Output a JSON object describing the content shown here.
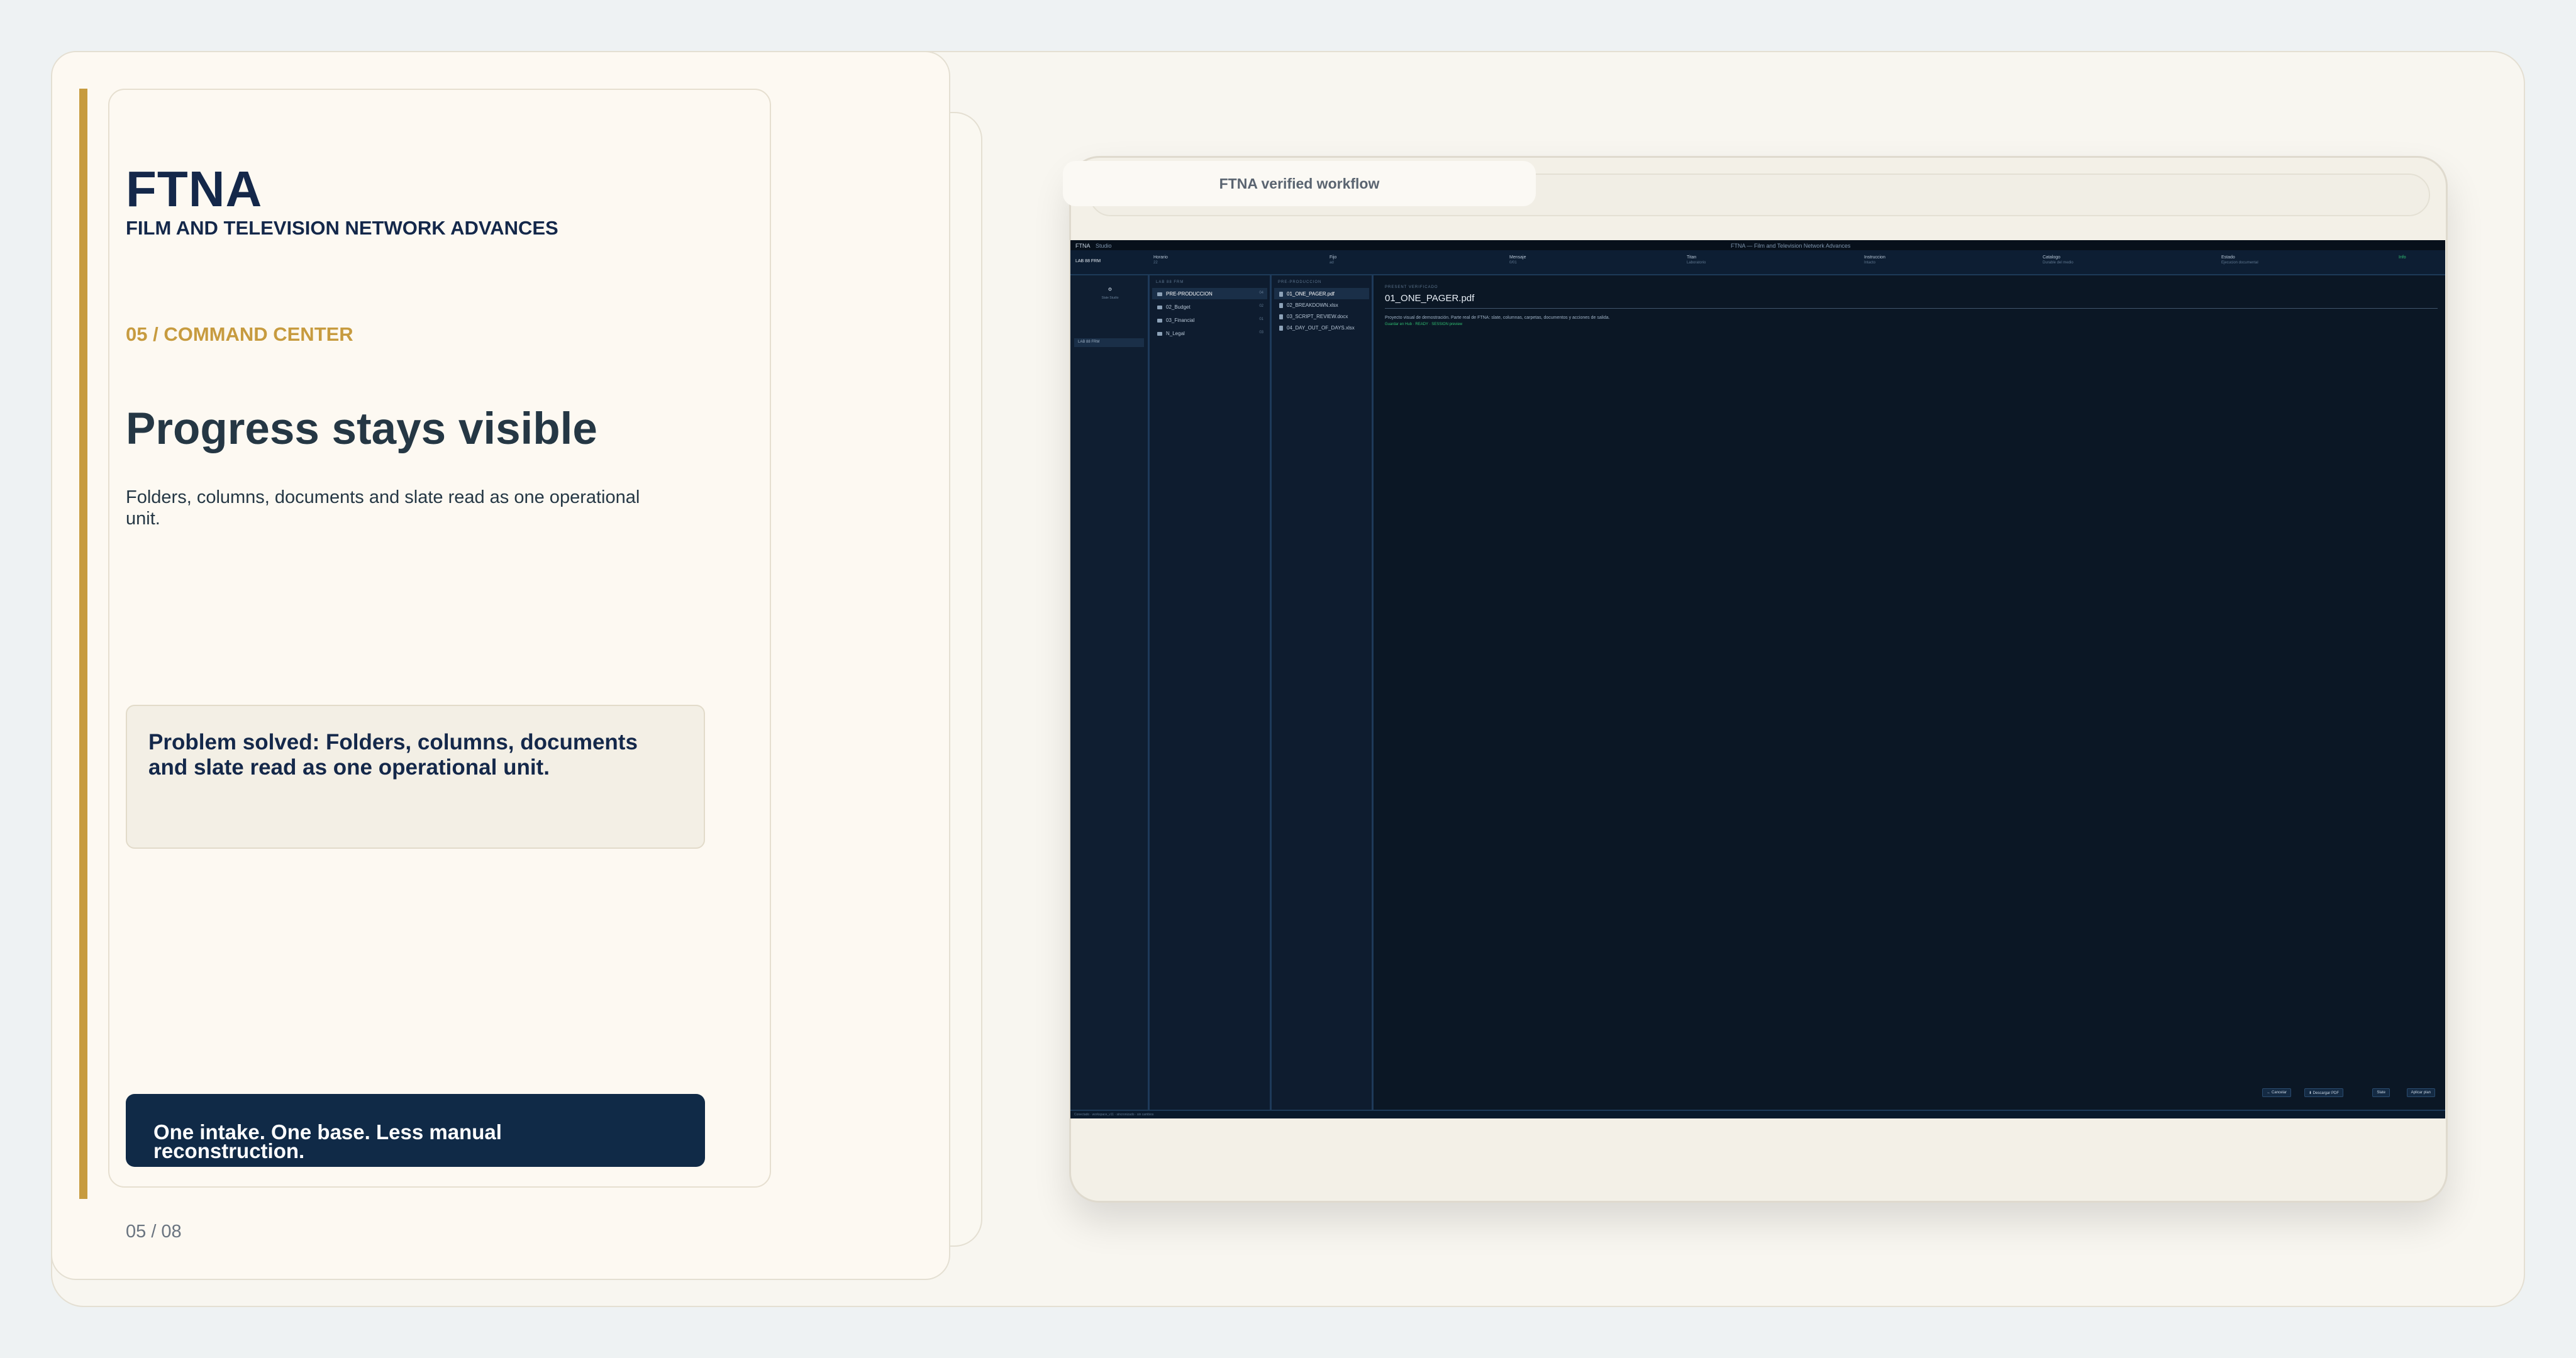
{
  "slide": {
    "brand": "FTNA",
    "brand_subtitle": "FILM AND TELEVISION NETWORK ADVANCES",
    "section": "05 / COMMAND CENTER",
    "headline": "Progress stays visible",
    "body": "Folders, columns, documents and slate read as one operational unit.",
    "problem": "Problem solved: Folders, columns, documents and slate read as one operational unit.",
    "cta": "One intake. One base. Less manual reconstruction.",
    "pager": "05 / 08"
  },
  "device": {
    "tab_label": "FTNA verified workflow"
  },
  "app": {
    "top_left": "FTNA",
    "top_menu": "Studio",
    "top_center": "FTNA — Film and Television Network Advances",
    "nav": [
      {
        "label": "Horario",
        "sub": "22"
      },
      {
        "label": "Fijo",
        "sub": "ad"
      },
      {
        "label": "Mensaje",
        "sub": "0/01"
      },
      {
        "label": "Titan",
        "sub": "Laboratorio"
      },
      {
        "label": "Instruccion",
        "sub": "Intacto"
      },
      {
        "label": "Catalogo",
        "sub": "Durable del medio"
      },
      {
        "label": "Estado",
        "sub": "Ejecucion documental"
      },
      {
        "label": "Info",
        "sub": ""
      }
    ],
    "side": {
      "logo_caption": "Slate Studio",
      "item": "LAB 88 FRM"
    },
    "folders_head": "LAB 88 FRM",
    "folders": [
      {
        "label": "PRE-PRODUCCION",
        "count": "04"
      },
      {
        "label": "02_Budget",
        "count": "02"
      },
      {
        "label": "03_Financial",
        "count": "01"
      },
      {
        "label": "N_Legal",
        "count": "03"
      }
    ],
    "files_head": "PRE-PRODUCCION",
    "files": [
      {
        "label": "01_ONE_PAGER.pdf"
      },
      {
        "label": "02_BREAKDOWN.xlsx"
      },
      {
        "label": "03_SCRIPT_REVIEW.docx"
      },
      {
        "label": "04_DAY_OUT_OF_DAYS.xlsx"
      }
    ],
    "doc": {
      "kicker": "PRESENT VERIFICADO",
      "title": "01_ONE_PAGER.pdf",
      "line1": "Proyecto visual de demostración. Parte real de FTNA: slate, columnas, carpetas, documentos y acciones de salida.",
      "line2": "Guardar en Hub · READY · SESSION preview"
    },
    "footer_buttons": [
      "← Cancelar",
      "⬇ Descargar PDF",
      "Slate",
      "Aplicar plan"
    ],
    "status": "Conectado · workspace_v11 · sincronizado · sin cambios"
  }
}
